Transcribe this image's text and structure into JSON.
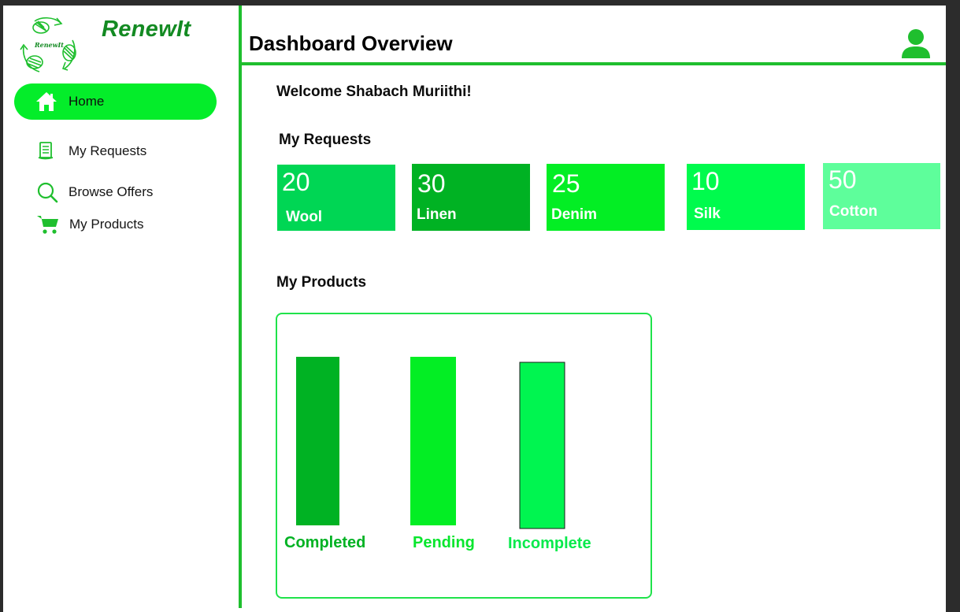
{
  "brand": {
    "name": "RenewIt",
    "logo_text": "RenewIt"
  },
  "sidebar": {
    "items": [
      {
        "label": "Home",
        "icon": "home-icon",
        "active": true
      },
      {
        "label": "My Requests",
        "icon": "receipt-icon"
      },
      {
        "label": "Browse Offers",
        "icon": "search-icon"
      },
      {
        "label": "My Products",
        "icon": "cart-icon"
      }
    ]
  },
  "header": {
    "title": "Dashboard Overview",
    "avatar_icon": "user-icon"
  },
  "welcome": "Welcome Shabach Muriithi!",
  "requests": {
    "title": "My Requests",
    "cards": [
      {
        "count": "20",
        "material": "Wool",
        "color": "#00d654"
      },
      {
        "count": "30",
        "material": "Linen",
        "color": "#00b223"
      },
      {
        "count": "25",
        "material": "Denim",
        "color": "#03ee24"
      },
      {
        "count": "10",
        "material": "Silk",
        "color": "#00fb4d"
      },
      {
        "count": "50",
        "material": "Cotton",
        "color": "#5efe9b"
      }
    ]
  },
  "products": {
    "title": "My Products",
    "chart_data": {
      "type": "bar",
      "categories": [
        "Completed",
        "Pending",
        "Incomplete"
      ],
      "colors": [
        "#00b223",
        "#03ee24",
        "#00f550"
      ],
      "label_colors": [
        "#00b223",
        "#07e62d",
        "#08ea4c"
      ]
    }
  }
}
